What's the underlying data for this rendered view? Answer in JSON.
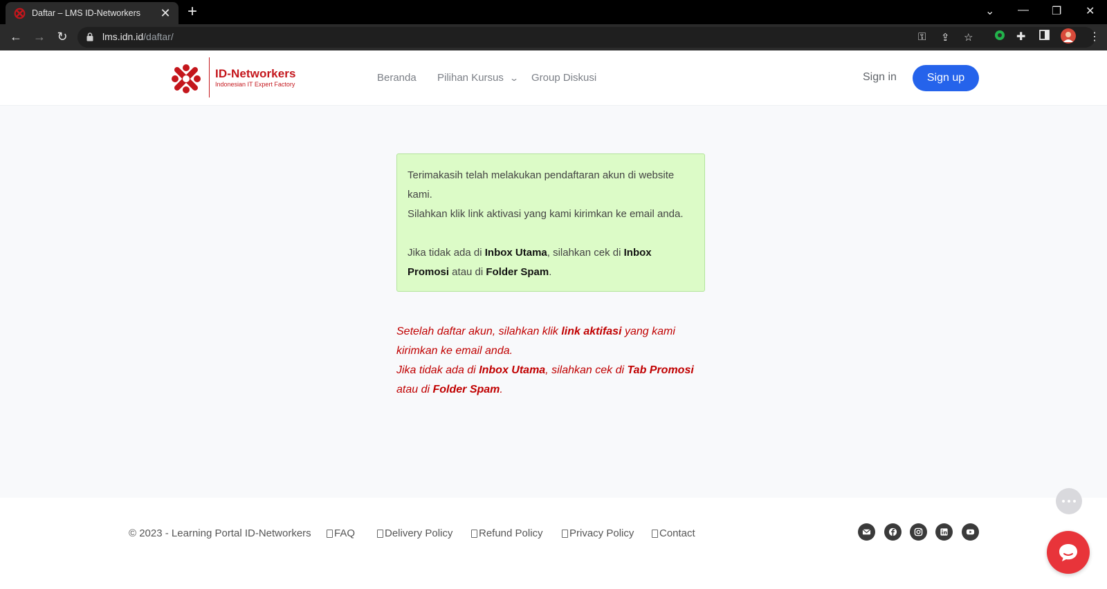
{
  "browser": {
    "tab_title": "Daftar – LMS ID-Networkers",
    "tab_close": "✕",
    "new_tab": "+",
    "url_host": "lms.idn.id",
    "url_path": "/daftar/"
  },
  "header": {
    "logo_name": "ID-Networkers",
    "logo_tagline": "Indonesian IT Expert Factory",
    "nav": [
      "Beranda",
      "Pilihan Kursus",
      "Group Diskusi"
    ],
    "signin": "Sign in",
    "signup": "Sign up"
  },
  "notice": {
    "line1": "Terimakasih telah melakukan pendaftaran akun di website kami.",
    "line2": "Silahkan klik link aktivasi yang kami kirimkan ke email anda.",
    "p2_a": "Jika tidak ada di ",
    "p2_b": "Inbox Utama",
    "p2_c": ", silahkan cek di ",
    "p2_d": "Inbox Promosi",
    "p2_e": " atau di ",
    "p2_f": "Folder Spam",
    "p2_g": "."
  },
  "warning": {
    "a": "Setelah daftar akun, silahkan klik ",
    "b": "link aktifasi",
    "c": " yang kami kirimkan ke email anda.",
    "d": "Jika tidak ada di ",
    "e": "Inbox Utama",
    "f": ", silahkan cek di ",
    "g": "Tab Promosi",
    "h": " atau di ",
    "i": "Folder Spam",
    "j": "."
  },
  "footer": {
    "copyright": "© 2023 - Learning Portal ID-Networkers",
    "links": [
      "FAQ",
      "Delivery Policy",
      "Refund Policy",
      "Privacy Policy",
      "Contact"
    ],
    "social_icons": [
      "email-icon",
      "facebook-icon",
      "instagram-icon",
      "linkedin-icon",
      "youtube-icon"
    ]
  },
  "colors": {
    "brand_red": "#c4161c",
    "signup_blue": "#2563eb",
    "notice_bg": "#dcfbc7",
    "warning_text": "#c00000",
    "chat_red": "#e8343a"
  }
}
